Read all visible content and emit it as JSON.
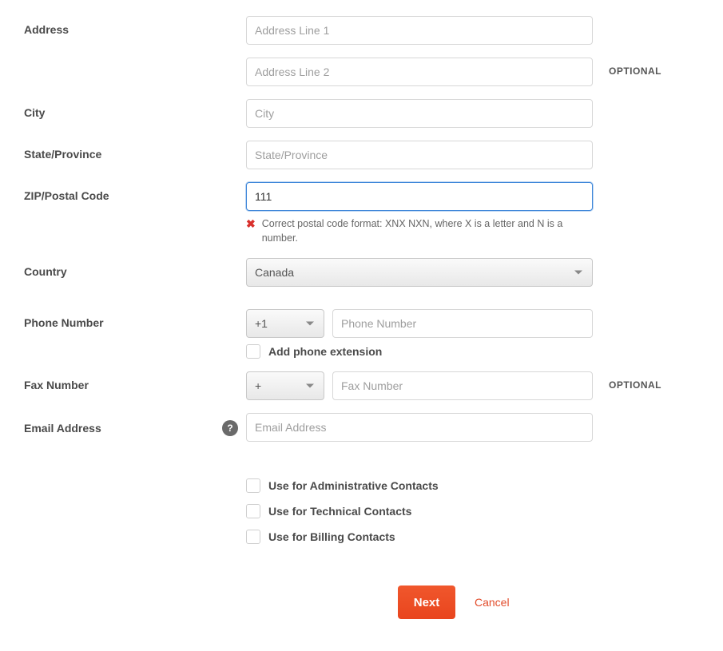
{
  "labels": {
    "address": "Address",
    "city": "City",
    "state": "State/Province",
    "zip": "ZIP/Postal Code",
    "country": "Country",
    "phone": "Phone Number",
    "fax": "Fax Number",
    "email": "Email Address",
    "optional": "OPTIONAL"
  },
  "placeholders": {
    "address1": "Address Line 1",
    "address2": "Address Line 2",
    "city": "City",
    "state": "State/Province",
    "phone": "Phone Number",
    "fax": "Fax Number",
    "email": "Email Address"
  },
  "values": {
    "zip": "111",
    "country": "Canada",
    "phone_code": "+1",
    "fax_code": "+"
  },
  "error": {
    "zip": "Correct postal code format: XNX NXN, where X is a letter and N is a number."
  },
  "checkboxes": {
    "phone_ext": "Add phone extension",
    "admin": "Use for Administrative Contacts",
    "tech": "Use for Technical Contacts",
    "billing": "Use for Billing Contacts"
  },
  "buttons": {
    "next": "Next",
    "cancel": "Cancel"
  },
  "icons": {
    "help": "?",
    "error_x": "✖"
  }
}
